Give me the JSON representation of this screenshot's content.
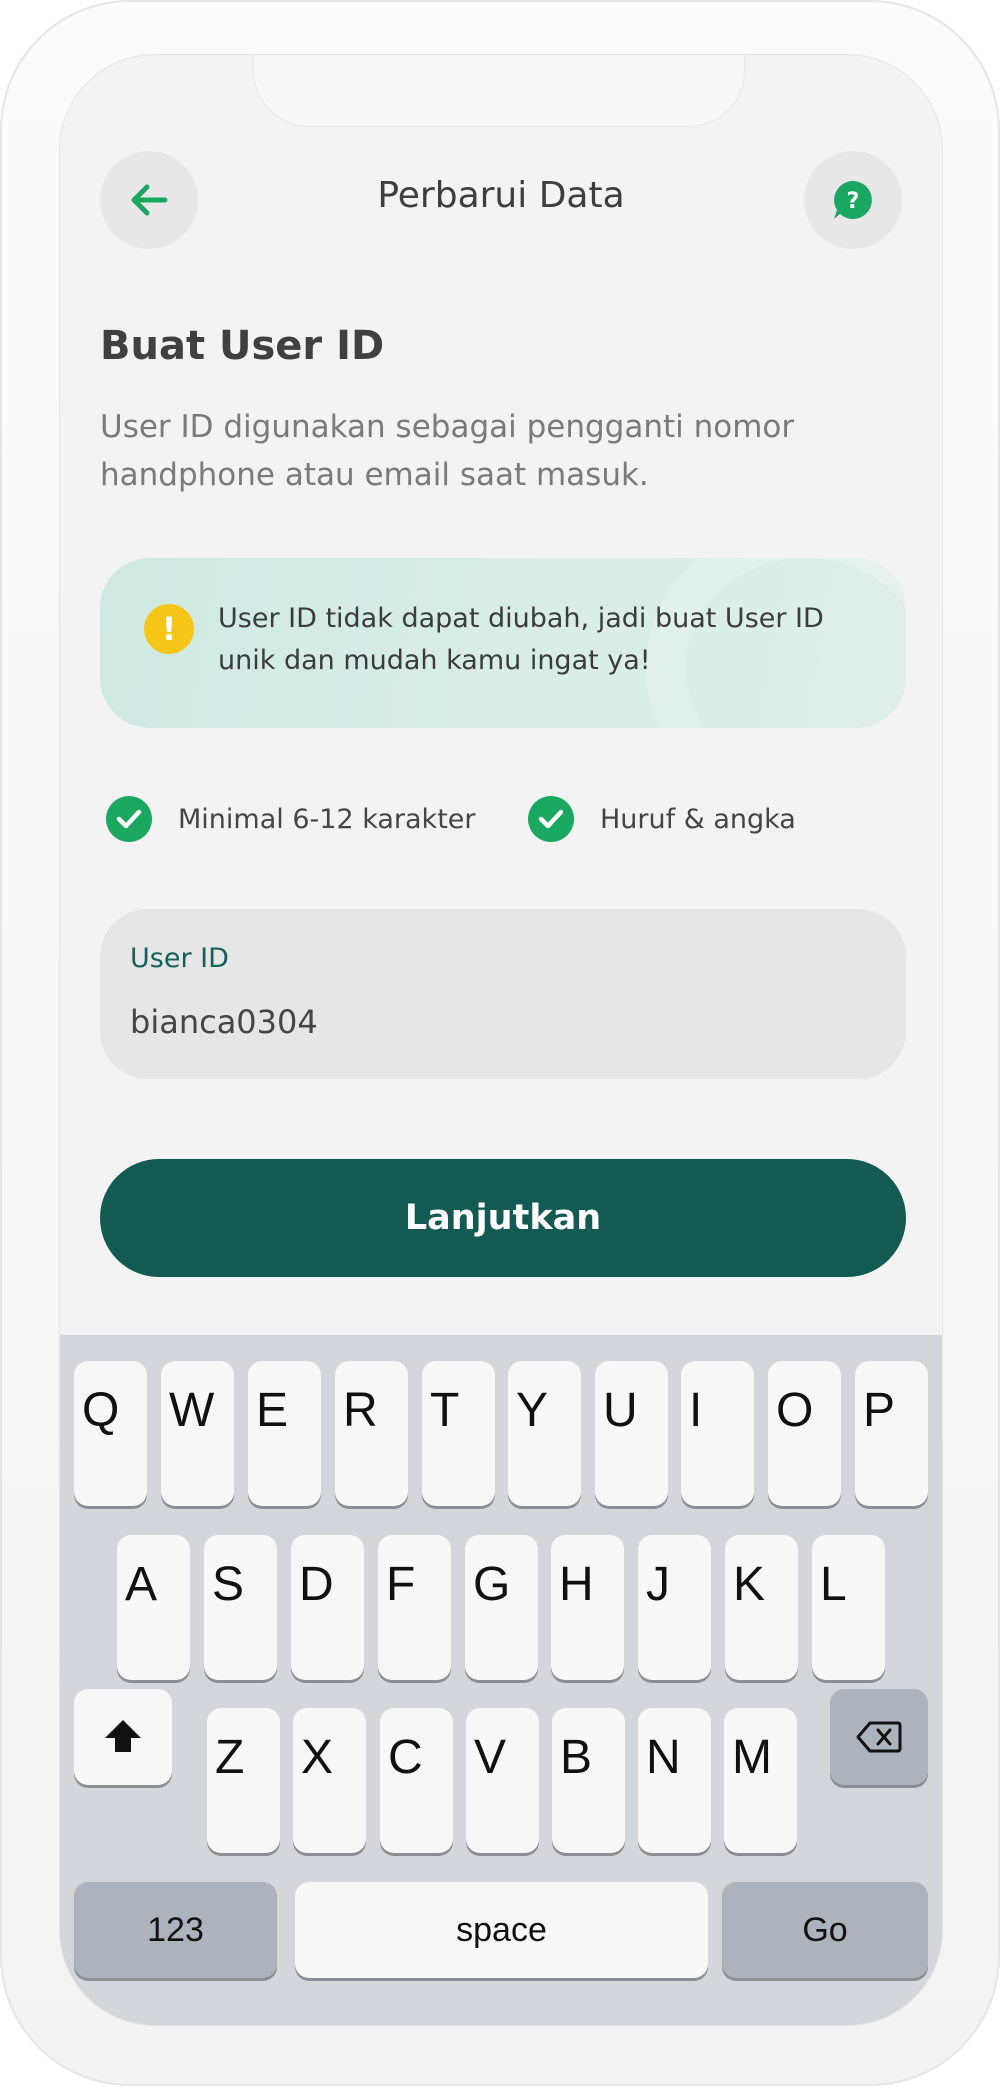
{
  "header": {
    "title": "Perbarui Data",
    "back_icon": "arrow-left-icon",
    "help_icon": "help-chat-icon",
    "help_glyph": "?"
  },
  "heading": "Buat User ID",
  "description": "User ID digunakan sebagai pengganti nomor handphone atau email saat masuk.",
  "notice": {
    "icon": "warning-icon",
    "glyph": "!",
    "text": "User ID tidak dapat diubah, jadi buat User ID unik dan mudah kamu ingat ya!"
  },
  "rules": [
    {
      "label": "Minimal 6-12 karakter",
      "satisfied": true
    },
    {
      "label": "Huruf & angka",
      "satisfied": true
    }
  ],
  "field": {
    "label": "User ID",
    "value": "bianca0304"
  },
  "cta_label": "Lanjutkan",
  "keyboard": {
    "row1": [
      "Q",
      "W",
      "E",
      "R",
      "T",
      "Y",
      "U",
      "I",
      "O",
      "P"
    ],
    "row2": [
      "A",
      "S",
      "D",
      "F",
      "G",
      "H",
      "J",
      "K",
      "L"
    ],
    "row3": [
      "Z",
      "X",
      "C",
      "V",
      "B",
      "N",
      "M"
    ],
    "numbers_label": "123",
    "space_label": "space",
    "go_label": "Go"
  },
  "colors": {
    "accent": "#135a53",
    "check": "#1aa860",
    "warning": "#f5c518",
    "notice_bg": "#d5ece5"
  }
}
